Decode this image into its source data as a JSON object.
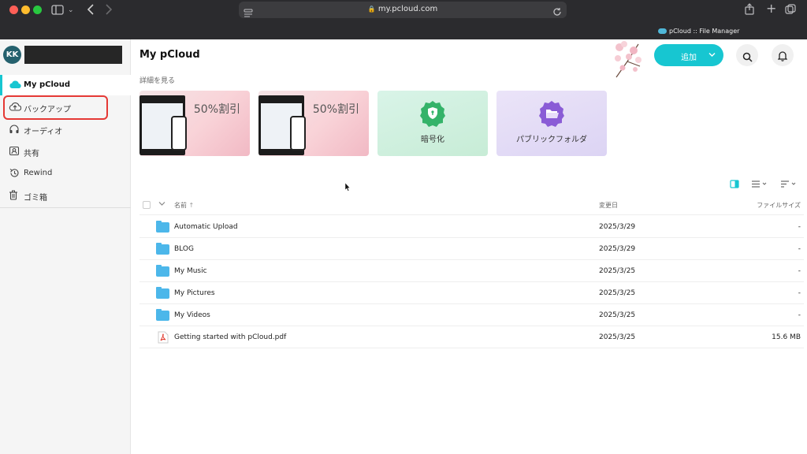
{
  "browser": {
    "url": "my.pcloud.com",
    "tab_title": "pCloud :: File Manager"
  },
  "user": {
    "initials": "KK"
  },
  "sidebar": {
    "items": [
      {
        "label": "My pCloud",
        "icon": "cloud-icon",
        "active": true
      },
      {
        "label": "バックアップ",
        "icon": "upload-cloud-icon",
        "active": false
      },
      {
        "label": "オーディオ",
        "icon": "headphones-icon",
        "active": false
      },
      {
        "label": "共有",
        "icon": "share-contact-icon",
        "active": false
      },
      {
        "label": "Rewind",
        "icon": "rewind-icon",
        "active": false
      },
      {
        "label": "ゴミ箱",
        "icon": "trash-icon",
        "active": false
      }
    ]
  },
  "header": {
    "title": "My pCloud",
    "add_label": "追加"
  },
  "promo": {
    "see_more": "詳細を見る",
    "cards": [
      {
        "label": "50%割引",
        "type": "promo"
      },
      {
        "label": "50%割引",
        "type": "promo"
      },
      {
        "label": "暗号化",
        "type": "feature",
        "icon": "shield-icon"
      },
      {
        "label": "パブリックフォルダ",
        "type": "feature",
        "icon": "folder-open-icon"
      }
    ]
  },
  "table": {
    "columns": {
      "name": "名前",
      "modified": "変更日",
      "size": "ファイルサイズ"
    },
    "rows": [
      {
        "name": "Automatic Upload",
        "date": "2025/3/29",
        "size": "-",
        "type": "folder"
      },
      {
        "name": "BLOG",
        "date": "2025/3/29",
        "size": "-",
        "type": "folder"
      },
      {
        "name": "My Music",
        "date": "2025/3/25",
        "size": "-",
        "type": "folder"
      },
      {
        "name": "My Pictures",
        "date": "2025/3/25",
        "size": "-",
        "type": "folder"
      },
      {
        "name": "My Videos",
        "date": "2025/3/25",
        "size": "-",
        "type": "folder"
      },
      {
        "name": "Getting started with pCloud.pdf",
        "date": "2025/3/25",
        "size": "15.6 MB",
        "type": "pdf"
      }
    ]
  },
  "colors": {
    "accent": "#17c6d1",
    "folder": "#4cb7ea",
    "highlight": "#e53935",
    "encryption": "#34b369",
    "public": "#8a5cd6"
  }
}
